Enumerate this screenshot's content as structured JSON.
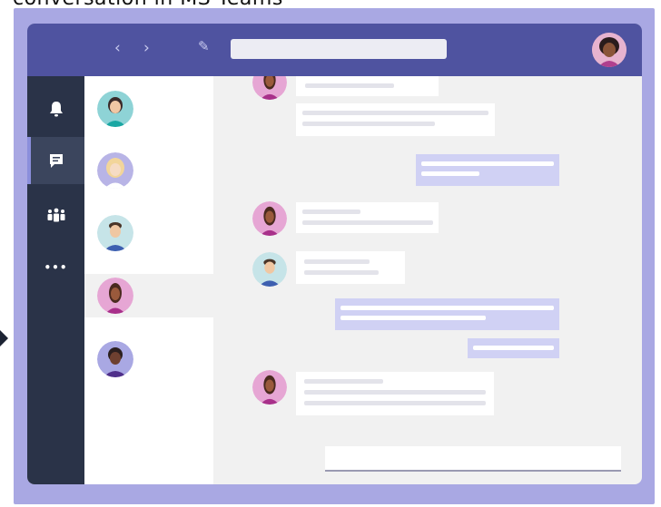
{
  "caption": "conversation in MS Teams",
  "colors": {
    "titlebar": "#4f53a0",
    "frame": "#a9a8e3",
    "rail": "#2a3348",
    "mine_bubble": "#d0d1f4"
  },
  "titlebar": {
    "back_icon": "‹",
    "forward_icon": "›",
    "compose_icon": "✎"
  },
  "rail_items": [
    {
      "icon": "bell-icon",
      "active": false
    },
    {
      "icon": "chat-icon",
      "active": true
    },
    {
      "icon": "teams-icon",
      "active": false
    },
    {
      "icon": "more-icon",
      "active": false
    }
  ],
  "more_glyph": "•••",
  "contacts": [
    {
      "avatar": "teal-woman"
    },
    {
      "avatar": "blonde-woman"
    },
    {
      "avatar": "man-blue"
    },
    {
      "avatar": "woman-pink",
      "selected": true
    },
    {
      "avatar": "woman-dark"
    }
  ]
}
